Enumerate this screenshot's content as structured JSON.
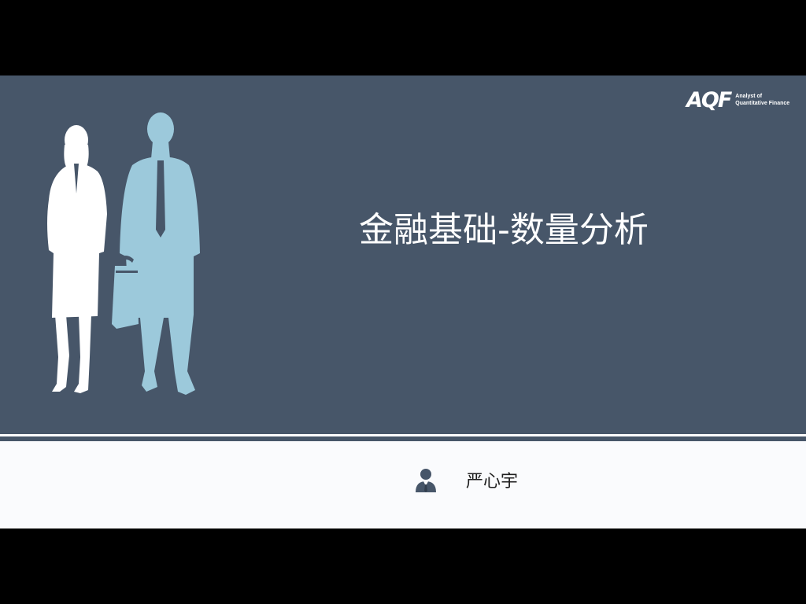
{
  "slide": {
    "title": "金融基础-数量分析",
    "presenter_name": "严心宇",
    "logo": {
      "mark": "AQF",
      "line1": "Analyst of",
      "line2": "Quantitative Finance"
    }
  },
  "icons": {
    "figures": "businesspeople-silhouette-icon",
    "avatar": "presenter-avatar-icon"
  },
  "colors": {
    "panel": "#475669",
    "page": "#fafbfd",
    "woman_silhouette": "#ffffff",
    "man_silhouette": "#9cc9db",
    "letterbox": "#000000"
  }
}
